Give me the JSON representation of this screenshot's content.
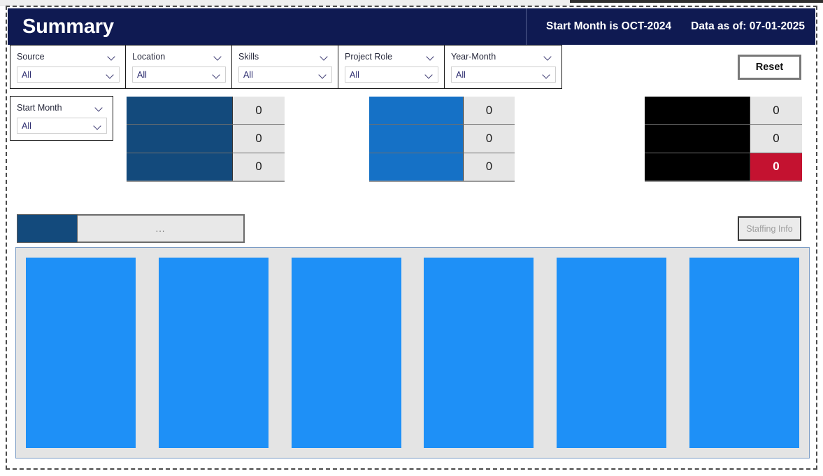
{
  "app": {
    "title": "Summary",
    "accent_navy": "#0f1a52",
    "accent_blue_dark": "#134a7c",
    "accent_blue": "#1571c6",
    "accent_blue_bright": "#1e90f7",
    "accent_red": "#c41230",
    "panel_gray": "#e4e4e4"
  },
  "header": {
    "title": "Summary",
    "start_month_stat": "Start Month is OCT-2024",
    "data_as_of_stat": "Data as of: 07-01-2025"
  },
  "filters": [
    {
      "label": "Source",
      "value": "All",
      "name": "source"
    },
    {
      "label": "Location",
      "value": "All",
      "name": "location"
    },
    {
      "label": "Skills",
      "value": "All",
      "name": "skills"
    },
    {
      "label": "Project Role",
      "value": "All",
      "name": "project-role"
    },
    {
      "label": "Year-Month",
      "value": "All",
      "name": "year-month"
    }
  ],
  "start_month_filter": {
    "label": "Start Month",
    "value": "All"
  },
  "buttons": {
    "reset": "Reset",
    "staffing_info": "Staffing Info"
  },
  "kpi_groups": [
    {
      "name": "kpi-group-a",
      "bar_color": "#134a7c",
      "rows": [
        {
          "label": "",
          "value": "0"
        },
        {
          "label": "",
          "value": "0"
        },
        {
          "label": "",
          "value": "0"
        }
      ]
    },
    {
      "name": "kpi-group-b",
      "bar_color": "#1571c6",
      "rows": [
        {
          "label": "",
          "value": "0"
        },
        {
          "label": "",
          "value": "0"
        },
        {
          "label": "",
          "value": "0"
        }
      ]
    },
    {
      "name": "kpi-group-c",
      "bar_color": "#000000",
      "rows": [
        {
          "label": "",
          "value": "0",
          "alert": false
        },
        {
          "label": "",
          "value": "0",
          "alert": false
        },
        {
          "label": "",
          "value": "0",
          "alert": true
        }
      ]
    }
  ],
  "tabs": {
    "active_label": "",
    "overflow_label": "..."
  },
  "chart_data": {
    "type": "bar",
    "title": "",
    "xlabel": "",
    "ylabel": "",
    "categories": [
      "",
      "",
      "",
      "",
      "",
      ""
    ],
    "values": [
      272,
      272,
      272,
      272,
      272,
      272
    ],
    "ylim": [
      0,
      272
    ],
    "grid": false,
    "legend": "none",
    "bar_color": "#1e90f7",
    "background": "#e4e4e4"
  }
}
